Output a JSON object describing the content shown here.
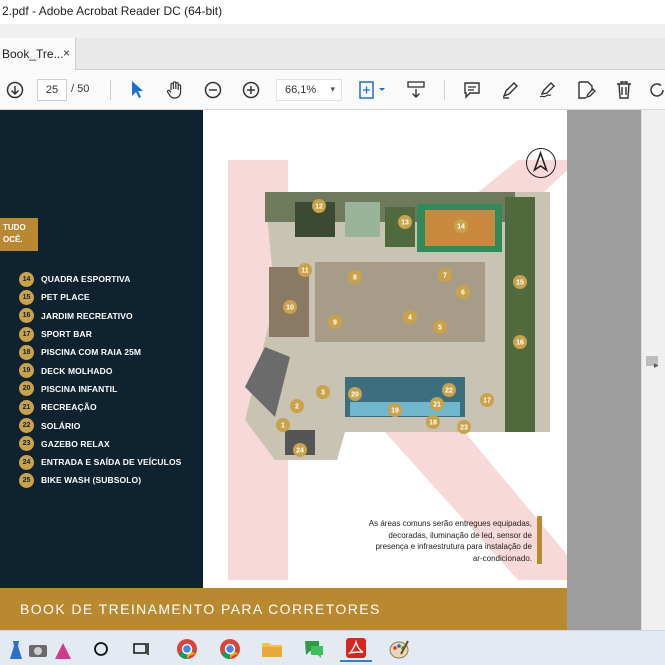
{
  "window": {
    "title": "2.pdf - Adobe Acrobat Reader DC (64-bit)"
  },
  "tab": {
    "label": "Book_Tre...",
    "close": "×"
  },
  "toolbar": {
    "page_current": "25",
    "page_total": "/ 50",
    "zoom": "66,1%"
  },
  "document": {
    "left_badge_line1": "TUDO",
    "left_badge_line2": "OCÊ.",
    "legend": [
      {
        "num": "14",
        "label": "QUADRA ESPORTIVA"
      },
      {
        "num": "15",
        "label": "PET PLACE"
      },
      {
        "num": "16",
        "label": "JARDIM RECREATIVO"
      },
      {
        "num": "17",
        "label": "SPORT BAR"
      },
      {
        "num": "18",
        "label": "PISCINA COM RAIA 25M"
      },
      {
        "num": "19",
        "label": "DECK MOLHADO"
      },
      {
        "num": "20",
        "label": "PISCINA INFANTIL"
      },
      {
        "num": "21",
        "label": "RECREAÇÃO"
      },
      {
        "num": "22",
        "label": "SOLÁRIO"
      },
      {
        "num": "23",
        "label": "GAZEBO RELAX"
      },
      {
        "num": "24",
        "label": "ENTRADA E SAÍDA DE VEÍCULOS"
      },
      {
        "num": "25",
        "label": "BIKE WASH (SUBSOLO)"
      }
    ],
    "plan_markers": [
      "1",
      "2",
      "3",
      "4",
      "5",
      "6",
      "7",
      "8",
      "9",
      "10",
      "11",
      "12",
      "13",
      "14",
      "15",
      "16",
      "17",
      "18",
      "19",
      "20",
      "21",
      "22",
      "23",
      "24"
    ],
    "note_lines": [
      "As áreas comuns serão entregues equipadas,",
      "decoradas, iluminação de led, sensor de",
      "presença e infraestrutura para instalação de",
      "ar-condicionado."
    ],
    "footer": "BOOK DE TREINAMENTO PARA CORRETORES",
    "brand_color": "#b8892e",
    "panel_color": "#0f2230"
  }
}
